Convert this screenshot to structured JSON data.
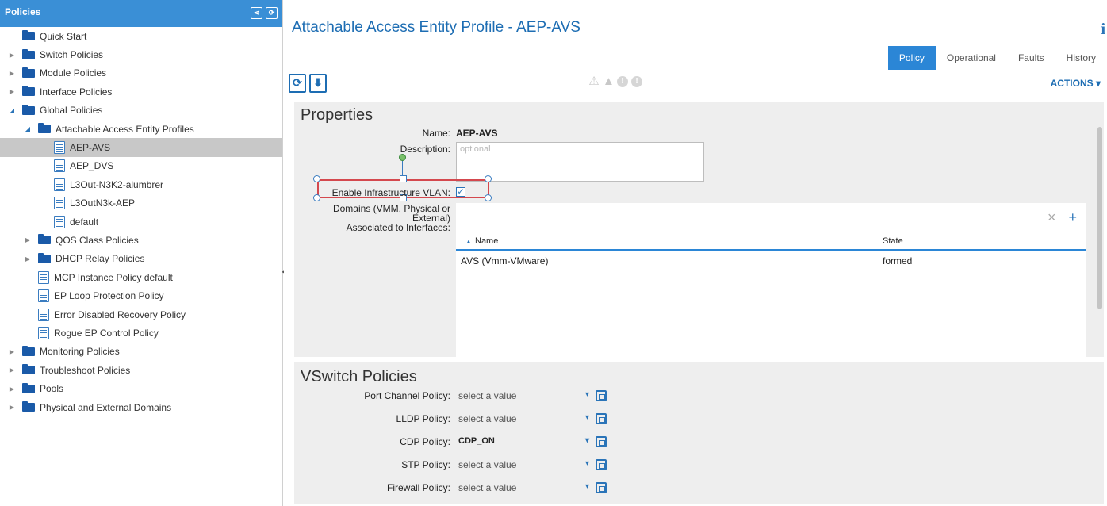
{
  "sidebar": {
    "title": "Policies",
    "header_icons": [
      "share-icon",
      "refresh-icon"
    ],
    "items": [
      {
        "label": "Quick Start",
        "icon": "folder-icon",
        "expander": "none",
        "indent": 0
      },
      {
        "label": "Switch Policies",
        "icon": "folder-icon",
        "expander": "closed",
        "indent": 0
      },
      {
        "label": "Module Policies",
        "icon": "folder-icon",
        "expander": "closed",
        "indent": 0
      },
      {
        "label": "Interface Policies",
        "icon": "folder-icon",
        "expander": "closed",
        "indent": 0
      },
      {
        "label": "Global Policies",
        "icon": "folder-icon",
        "expander": "open",
        "indent": 0
      },
      {
        "label": "Attachable Access Entity Profiles",
        "icon": "folder-icon",
        "expander": "open",
        "indent": 1
      },
      {
        "label": "AEP-AVS",
        "icon": "document-icon",
        "expander": "none",
        "indent": 2,
        "selected": true
      },
      {
        "label": "AEP_DVS",
        "icon": "document-icon",
        "expander": "none",
        "indent": 2
      },
      {
        "label": "L3Out-N3K2-alumbrer",
        "icon": "document-icon",
        "expander": "none",
        "indent": 2
      },
      {
        "label": "L3OutN3k-AEP",
        "icon": "document-icon",
        "expander": "none",
        "indent": 2
      },
      {
        "label": "default",
        "icon": "document-icon",
        "expander": "none",
        "indent": 2
      },
      {
        "label": "QOS Class Policies",
        "icon": "folder-icon",
        "expander": "closed",
        "indent": 1
      },
      {
        "label": "DHCP Relay Policies",
        "icon": "folder-icon",
        "expander": "closed",
        "indent": 1
      },
      {
        "label": "MCP Instance Policy default",
        "icon": "document-icon",
        "expander": "none",
        "indent": 1
      },
      {
        "label": "EP Loop Protection Policy",
        "icon": "document-icon",
        "expander": "none",
        "indent": 1
      },
      {
        "label": "Error Disabled Recovery Policy",
        "icon": "document-icon",
        "expander": "none",
        "indent": 1
      },
      {
        "label": "Rogue EP Control Policy",
        "icon": "document-icon",
        "expander": "none",
        "indent": 1
      },
      {
        "label": "Monitoring Policies",
        "icon": "folder-icon",
        "expander": "closed",
        "indent": 0
      },
      {
        "label": "Troubleshoot Policies",
        "icon": "folder-icon",
        "expander": "closed",
        "indent": 0
      },
      {
        "label": "Pools",
        "icon": "folder-icon",
        "expander": "closed",
        "indent": 0
      },
      {
        "label": "Physical and External Domains",
        "icon": "folder-icon",
        "expander": "closed",
        "indent": 0
      }
    ]
  },
  "header": {
    "title": "Attachable Access Entity Profile - AEP-AVS",
    "info": "i",
    "tabs": [
      {
        "label": "Policy",
        "active": true
      },
      {
        "label": "Operational",
        "active": false
      },
      {
        "label": "Faults",
        "active": false
      },
      {
        "label": "History",
        "active": false
      }
    ]
  },
  "toolbar": {
    "refresh_icon": "refresh-icon",
    "download_icon": "download-icon",
    "fault_icons": [
      "critical-fault-icon",
      "major-fault-icon",
      "minor-fault-icon",
      "warning-fault-icon"
    ],
    "actions_label": "ACTIONS",
    "actions_caret": "▾"
  },
  "properties": {
    "section_title": "Properties",
    "name_label": "Name:",
    "name_value": "AEP-AVS",
    "description_label": "Description:",
    "description_placeholder": "optional",
    "infra_vlan_label": "Enable Infrastructure VLAN:",
    "infra_vlan_checked": true,
    "domains_label_line1": "Domains (VMM, Physical or External)",
    "domains_label_line2": "Associated to Interfaces:",
    "table": {
      "columns": [
        "Name",
        "State"
      ],
      "sort_indicator": "▲",
      "rows": [
        {
          "name": "AVS (Vmm-VMware)",
          "state": "formed"
        }
      ]
    }
  },
  "vswitch": {
    "section_title": "VSwitch Policies",
    "fields": [
      {
        "label": "Port Channel Policy:",
        "value": "select a value",
        "selected": false
      },
      {
        "label": "LLDP Policy:",
        "value": "select a value",
        "selected": false
      },
      {
        "label": "CDP Policy:",
        "value": "CDP_ON",
        "selected": true
      },
      {
        "label": "STP Policy:",
        "value": "select a value",
        "selected": false
      },
      {
        "label": "Firewall Policy:",
        "value": "select a value",
        "selected": false
      }
    ]
  },
  "colors": {
    "accent": "#2b86d6",
    "title_blue": "#1d6db3",
    "selection_red": "#d4484e",
    "panel_bg": "#eeeeee"
  }
}
